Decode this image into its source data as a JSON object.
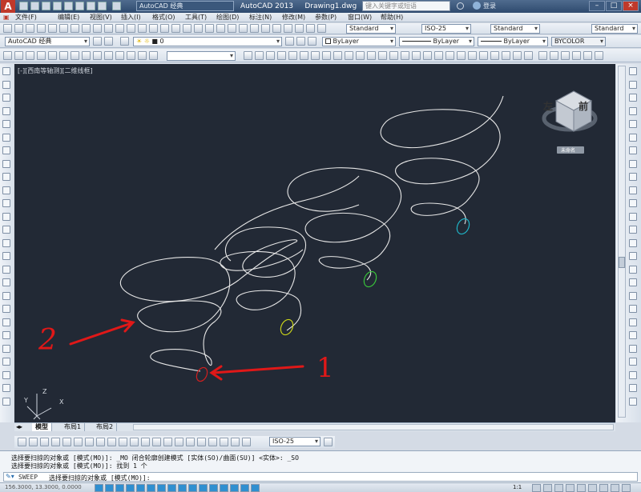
{
  "titlebar": {
    "app_logo": "A",
    "workspace": "AutoCAD 经典",
    "app_title": "AutoCAD 2013",
    "document": "Drawing1.dwg",
    "search_placeholder": "键入关键字或短语",
    "login_label": "登录"
  },
  "menubar": {
    "items": [
      "文件(F)",
      "编辑(E)",
      "视图(V)",
      "插入(I)",
      "格式(O)",
      "工具(T)",
      "绘图(D)",
      "标注(N)",
      "修改(M)",
      "参数(P)",
      "窗口(W)",
      "帮助(H)"
    ]
  },
  "toolbar2": {
    "workspace": "AutoCAD 经典",
    "layer": "0",
    "text_style": "Standard",
    "dim_style": "ISO-25",
    "table_style": "Standard",
    "mleader_style": "Standard"
  },
  "properties": {
    "color": "ByLayer",
    "linetype": "ByLayer",
    "lineweight": "ByLayer",
    "plotstyle": "BYCOLOR"
  },
  "canvas": {
    "view_label": "[-][西南等轴测][二维线框]",
    "viewcube_face_left": "左",
    "viewcube_face_front": "前",
    "viewcube_wcs": "未命名",
    "annotation_1": "1",
    "annotation_2": "2",
    "ucs_x": "X",
    "ucs_y": "Y",
    "ucs_z": "Z"
  },
  "tabs": {
    "items": [
      "模型",
      "布局1",
      "布局2"
    ]
  },
  "dimbar": {
    "dim_style": "ISO-25"
  },
  "command": {
    "line1": "选择要扫掠的对象或 [模式(MO)]: _MO 闭合轮廓创建模式 [实体(SO)/曲面(SU)] <实体>: _SO",
    "line2": "选择要扫掠的对象或 [模式(MO)]: 找到 1 个",
    "prompt_prefix": "SWEEP",
    "prompt": "选择要扫掠的对象或 [模式(MO)]:"
  },
  "status": {
    "coords": "156.3000, 13.3000, 0.0000",
    "scale": "1:1"
  },
  "colors": {
    "canvas_bg": "#222935",
    "curve": "#e6e6e6",
    "marker_red": "#d11f1f",
    "marker_yellow": "#c8d21a",
    "marker_green": "#39c23a",
    "marker_cyan": "#1fb3c6"
  }
}
